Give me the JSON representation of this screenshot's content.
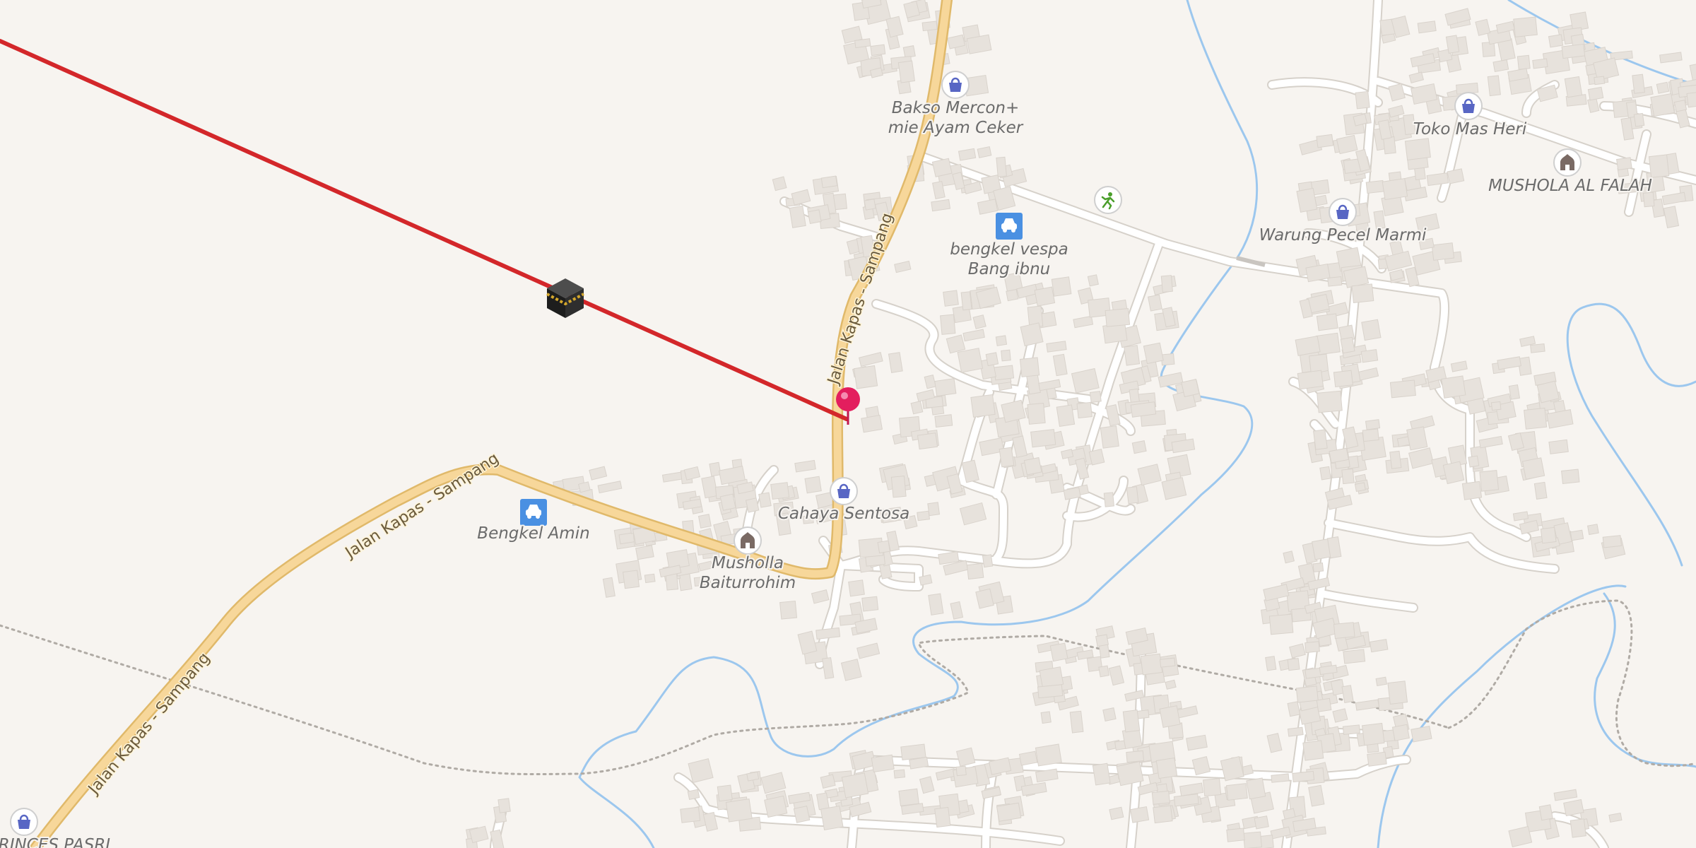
{
  "map": {
    "colors": {
      "background": "#f7f4f0",
      "building": "#e7e2dc",
      "minor_road": "#ffffff",
      "main_road": "#f7d79a",
      "water": "#9cc7ee",
      "path": "#b0aba5",
      "qibla_line": "#d3272a",
      "pin": "#e31e5e",
      "shop_icon": "#5866c4",
      "car_icon": "#4a90e2",
      "mosque_icon": "#7a6a64",
      "sport_icon": "#4a9e2a"
    },
    "road_labels": [
      "Jalan Kapas - Sampang",
      "Jalan Kapas - Sampang",
      "Jalan Kapas - Sampang"
    ],
    "pois": [
      {
        "icon": "shop-icon",
        "lines": [
          "Bakso Mercon+",
          "mie Ayam Ceker"
        ]
      },
      {
        "icon": "car-repair-icon",
        "lines": [
          "bengkel vespa",
          "Bang ibnu"
        ]
      },
      {
        "icon": "shop-icon",
        "lines": [
          "Toko Mas Heri"
        ]
      },
      {
        "icon": "mosque-icon",
        "lines": [
          "MUSHOLA AL FALAH"
        ]
      },
      {
        "icon": "shop-icon",
        "lines": [
          "Warung Pecel Marmi"
        ]
      },
      {
        "icon": "sport-icon",
        "lines": []
      },
      {
        "icon": "shop-icon",
        "lines": [
          "Cahaya Sentosa"
        ]
      },
      {
        "icon": "mosque-icon",
        "lines": [
          "Musholla",
          "Baiturrohim"
        ]
      },
      {
        "icon": "car-repair-icon",
        "lines": [
          "Bengkel Amin"
        ]
      },
      {
        "icon": "shop-icon",
        "lines": [
          "PRINCES PASRI"
        ]
      }
    ],
    "markers": {
      "location_pin": "location-pin-icon",
      "kaaba": "kaaba-icon"
    }
  }
}
